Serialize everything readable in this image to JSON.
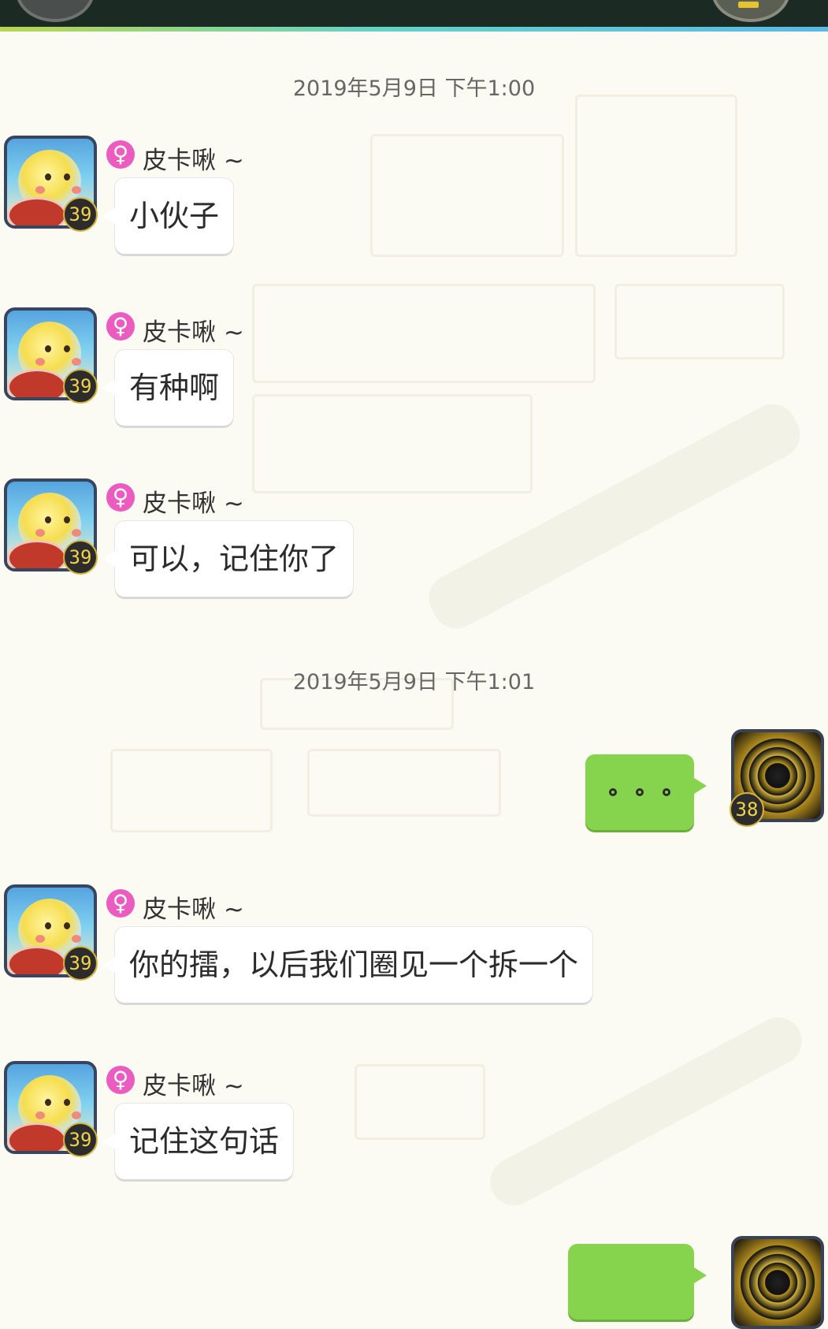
{
  "header": {
    "title": ""
  },
  "timestamps": [
    "2019年5月9日 下午1:00",
    "2019年5月9日 下午1:01"
  ],
  "contact": {
    "name": "皮卡啾 ~",
    "gender_icon": "female-icon",
    "level": "39"
  },
  "me": {
    "level": "38"
  },
  "messages": [
    {
      "from": "contact",
      "text": "小伙子"
    },
    {
      "from": "contact",
      "text": "有种啊"
    },
    {
      "from": "contact",
      "text": "可以，记住你了"
    },
    {
      "from": "me",
      "text": "。。。"
    },
    {
      "from": "contact",
      "text": "你的擂，以后我们圈见一个拆一个"
    },
    {
      "from": "contact",
      "text": "记住这句话"
    },
    {
      "from": "me",
      "text": ""
    }
  ],
  "colors": {
    "outgoing_bubble": "#86d34e",
    "incoming_bubble": "#ffffff",
    "female": "#ec5bc0",
    "header_bg": "#1c2a24"
  }
}
